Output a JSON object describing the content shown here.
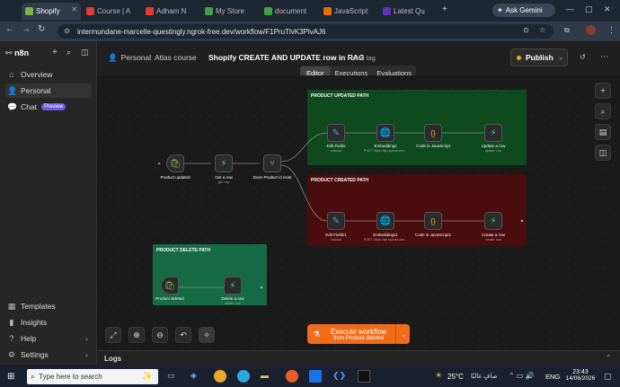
{
  "browser": {
    "tabs": [
      {
        "label": "Shopify",
        "color": "#7cb342"
      },
      {
        "label": "Course | A",
        "color": "#e53935"
      },
      {
        "label": "Adham N",
        "color": "#e53935"
      },
      {
        "label": "My Store",
        "color": "#43a047"
      },
      {
        "label": "document",
        "color": "#43a047"
      },
      {
        "label": "JavaScript",
        "color": "#ef6c00"
      },
      {
        "label": "Latest Qu",
        "color": "#5e35b1"
      }
    ],
    "ask_gemini": "Ask Gemini",
    "url": "intermundane-marcelle-questingly.ngrok-free.dev/workflow/F1PruTlvK3PlvAJ6"
  },
  "sidebar": {
    "logo": "n8n",
    "items": [
      {
        "label": "Overview",
        "icon": "home-icon"
      },
      {
        "label": "Personal",
        "icon": "user-icon"
      },
      {
        "label": "Chat",
        "icon": "chat-icon",
        "badge": "Preview"
      }
    ],
    "bottom": [
      {
        "label": "Templates",
        "icon": "templates-icon"
      },
      {
        "label": "Insights",
        "icon": "insights-icon"
      },
      {
        "label": "Help",
        "icon": "help-icon"
      },
      {
        "label": "Settings",
        "icon": "settings-icon"
      }
    ]
  },
  "header": {
    "breadcrumb_personal": "Personal",
    "breadcrumb_folder": "Atlas course",
    "workflow_name": "Shopify CREATE AND UPDATE row in RAG",
    "add_tag": "+ Add tag",
    "publish": "Publish",
    "tabs": [
      "Editor",
      "Executions",
      "Evaluations"
    ]
  },
  "canvas": {
    "groups": [
      {
        "title": "PRODUCT UPDATED PATH",
        "color": "#0e4a1d"
      },
      {
        "title": "PRODUCT CREATED PATH",
        "color": "#4a0c0c"
      },
      {
        "title": "PRODUCT DELETE PATH",
        "color": "#146b45"
      }
    ],
    "nodes": {
      "product_updated": {
        "label": "Product updated"
      },
      "get_row": {
        "label": "Get a row",
        "sub": "get: row"
      },
      "product_exist": {
        "label": "Does Product id exist"
      },
      "edit_fields": {
        "label": "Edit Fields",
        "sub": "manual"
      },
      "embeddings": {
        "label": "Embeddings",
        "sub": "POST: https://api.openai.com..."
      },
      "code_js": {
        "label": "Code in JavaScript",
        "sub": ""
      },
      "update_row": {
        "label": "Update a row",
        "sub": "update: row"
      },
      "edit_fields1": {
        "label": "Edit Fields1",
        "sub": "manual"
      },
      "embeddings1": {
        "label": "Embeddings1",
        "sub": "POST: https://api.openai.com..."
      },
      "code_js1": {
        "label": "Code in JavaScript1",
        "sub": ""
      },
      "create_row": {
        "label": "Create a row",
        "sub": "create: row"
      },
      "product_deleted": {
        "label": "Product deleted"
      },
      "delete_row": {
        "label": "Delete a row",
        "sub": "delete: row"
      }
    },
    "execute_title": "Execute workflow",
    "execute_sub": "from Product deleted"
  },
  "logs": {
    "label": "Logs"
  },
  "taskbar": {
    "search_placeholder": "Type here to search",
    "weather": "25°C",
    "weather_desc": "صافٍ غالبًا",
    "lang": "ENG",
    "time": "23:43",
    "date": "14/06/2026"
  }
}
